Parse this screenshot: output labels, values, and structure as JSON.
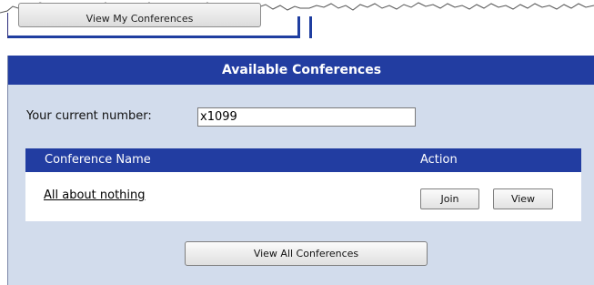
{
  "tab_button": {
    "label": "View My Conferences"
  },
  "panel": {
    "title": "Available Conferences"
  },
  "current_number": {
    "label": "Your current number:",
    "value": "x1099"
  },
  "table": {
    "headers": {
      "name": "Conference Name",
      "action": "Action"
    },
    "rows": [
      {
        "name": "All about nothing",
        "join_label": "Join",
        "view_label": "View"
      }
    ]
  },
  "view_all_button": {
    "label": "View All Conferences"
  },
  "colors": {
    "header_blue": "#223da1",
    "panel_background": "#d2dcec"
  }
}
